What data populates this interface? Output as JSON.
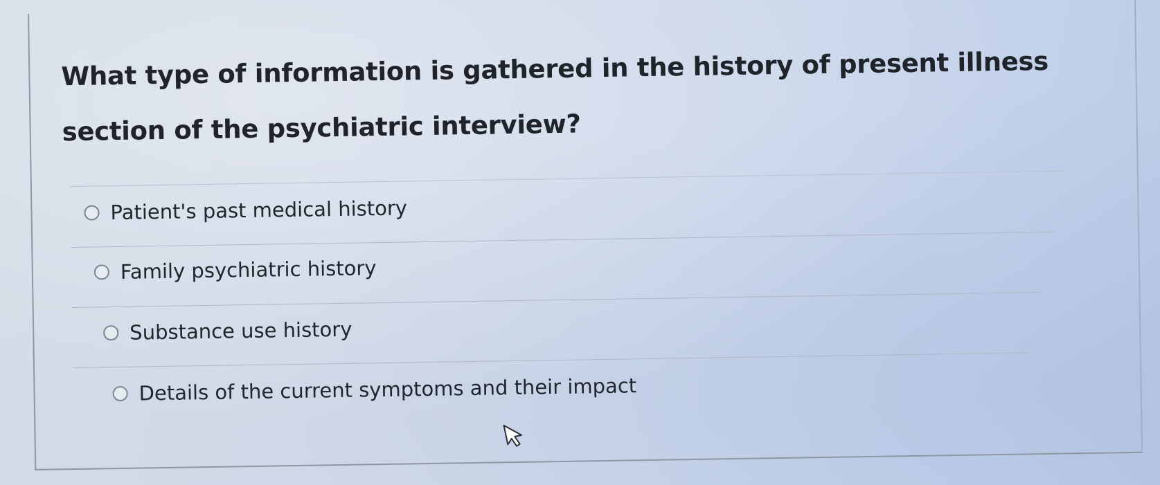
{
  "question": {
    "text": "What type of information is gathered in the history of present illness section of the psychiatric interview?"
  },
  "options": [
    {
      "label": "Patient's past medical history",
      "selected": false
    },
    {
      "label": "Family psychiatric history",
      "selected": false
    },
    {
      "label": "Substance use history",
      "selected": false
    },
    {
      "label": "Details of the current symptoms and their impact",
      "selected": false
    }
  ],
  "icons": {
    "radio": "radio-button-icon",
    "cursor": "mouse-pointer-icon"
  },
  "colors": {
    "text": "#1f242b",
    "radio_border": "#7b8592",
    "background": "#cad6ea"
  }
}
